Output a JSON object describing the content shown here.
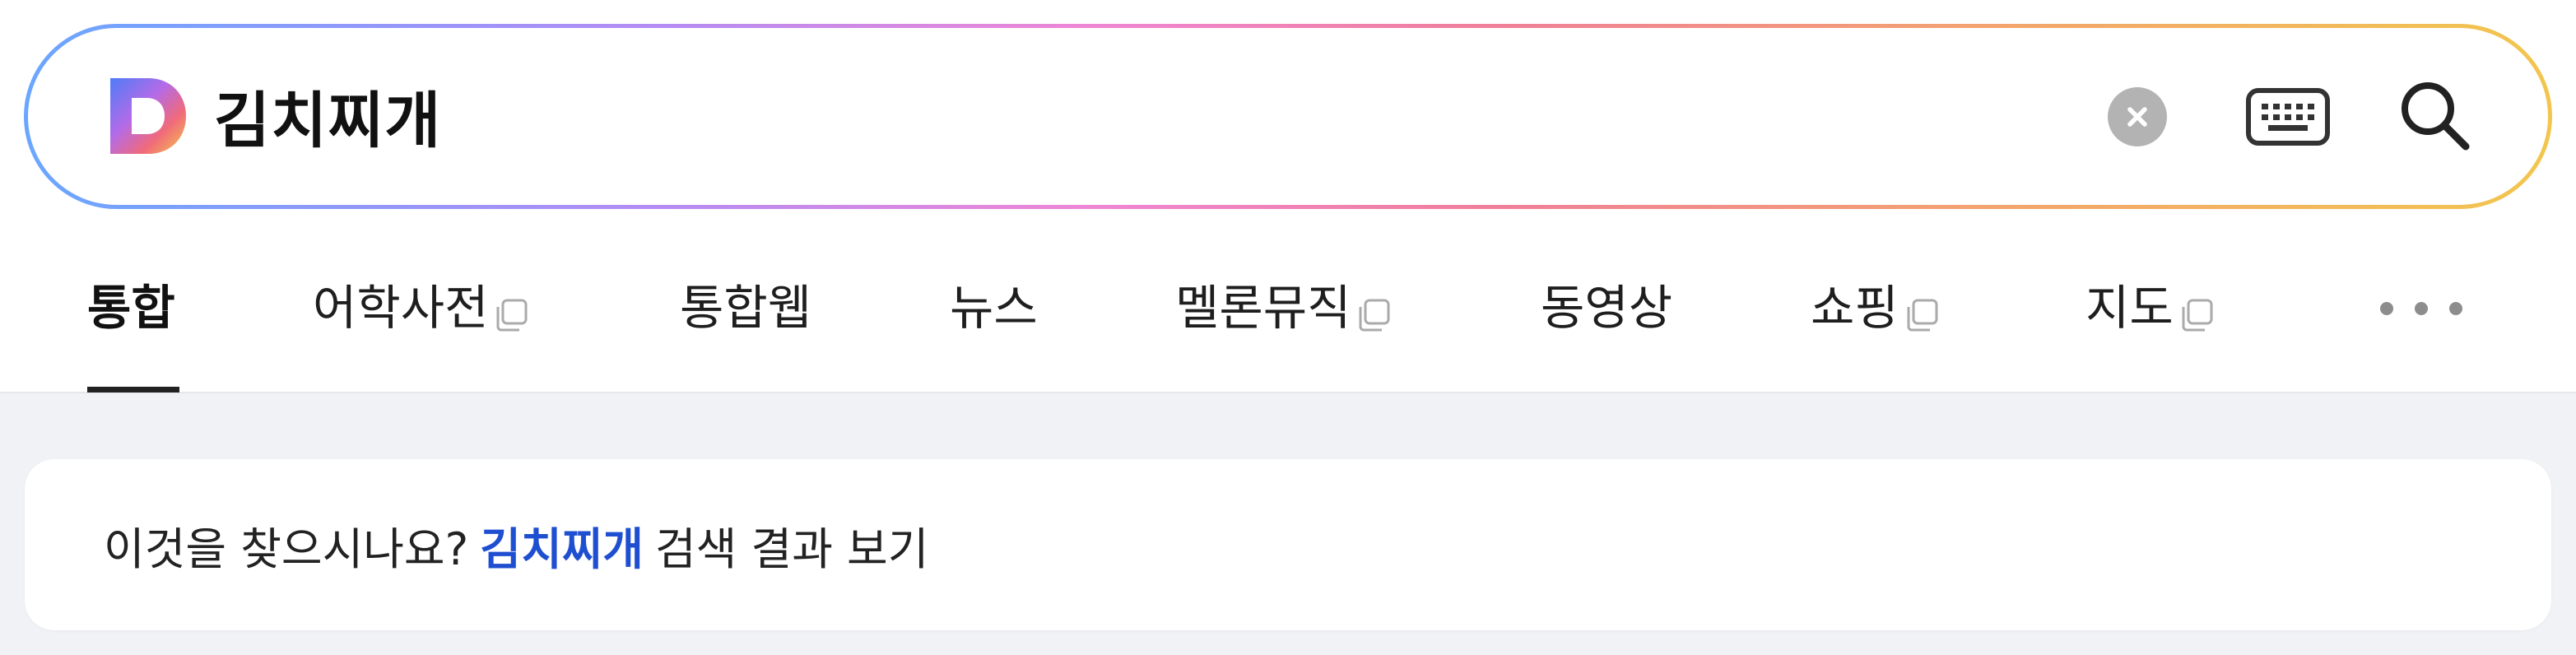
{
  "search": {
    "query": "김치찌개",
    "logo_letter": "D"
  },
  "icons": {
    "logo": "daum-logo-icon",
    "clear": "clear-icon",
    "keyboard": "keyboard-icon",
    "search": "search-icon",
    "external": "external-window-icon",
    "more": "more-dots-icon"
  },
  "tabs": [
    {
      "label": "통합",
      "active": true,
      "external": false
    },
    {
      "label": "어학사전",
      "active": false,
      "external": true
    },
    {
      "label": "통합웹",
      "active": false,
      "external": false
    },
    {
      "label": "뉴스",
      "active": false,
      "external": false
    },
    {
      "label": "멜론뮤직",
      "active": false,
      "external": true
    },
    {
      "label": "동영상",
      "active": false,
      "external": false
    },
    {
      "label": "쇼핑",
      "active": false,
      "external": true
    },
    {
      "label": "지도",
      "active": false,
      "external": true
    }
  ],
  "suggestion": {
    "prefix": "이것을 찾으시나요?",
    "keyword": "김치찌개",
    "suffix": "검색 결과 보기"
  },
  "colors": {
    "accent_blue": "#1f4fd1",
    "page_bg": "#f1f2f5",
    "gradient": [
      "#6aa6ff",
      "#b48cf4",
      "#ef86d6",
      "#f07f9a",
      "#f3a46e",
      "#f2c64e"
    ]
  }
}
